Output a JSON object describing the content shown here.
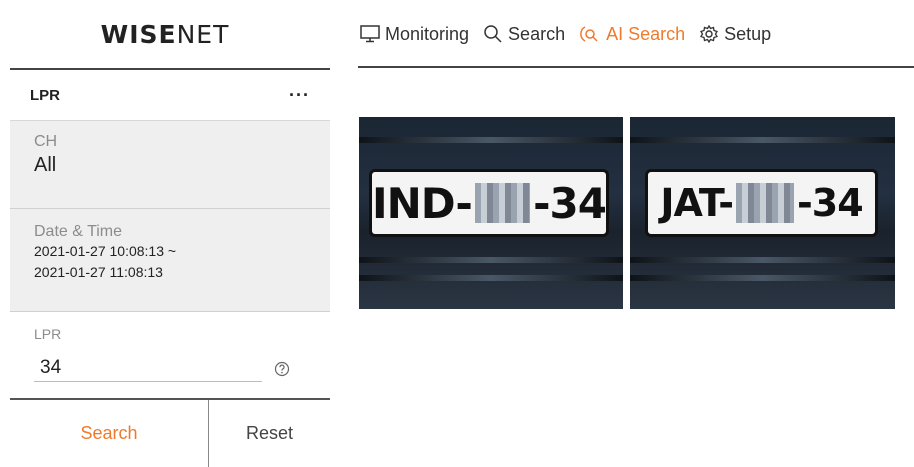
{
  "app": {
    "logo_bold": "W",
    "logo_mid": "ISE",
    "logo_thin": "NET"
  },
  "nav": {
    "items": [
      {
        "label": "Monitoring",
        "icon": "monitor-icon"
      },
      {
        "label": "Search",
        "icon": "search-icon"
      },
      {
        "label": "AI Search",
        "icon": "ai-search-icon",
        "active": true
      },
      {
        "label": "Setup",
        "icon": "gear-icon"
      }
    ]
  },
  "panel": {
    "title": "LPR",
    "more": "···",
    "ch_label": "CH",
    "ch_value": "All",
    "datetime_label": "Date & Time",
    "datetime_start": "2021-01-27 10:08:13 ~",
    "datetime_end": "2021-01-27 11:08:13",
    "lpr_label": "LPR",
    "lpr_value": "34",
    "search_button": "Search",
    "reset_button": "Reset"
  },
  "results": [
    {
      "plate_prefix": "IND-",
      "plate_suffix": "-34"
    },
    {
      "plate_prefix": "JAT-",
      "plate_suffix": "-34"
    }
  ],
  "colors": {
    "accent": "#f07a2c",
    "panel_bg": "#efefef"
  }
}
